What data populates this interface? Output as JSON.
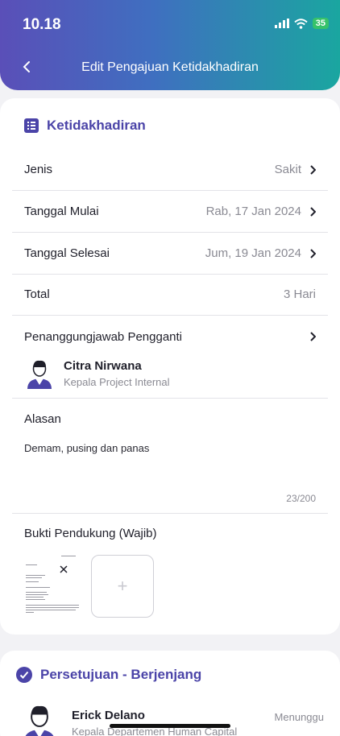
{
  "status_bar": {
    "time": "10.18",
    "battery": "35"
  },
  "header": {
    "title": "Edit Pengajuan Ketidakhadiran"
  },
  "absence_section": {
    "title": "Ketidakhadiran",
    "rows": [
      {
        "label": "Jenis",
        "value": "Sakit"
      },
      {
        "label": "Tanggal Mulai",
        "value": "Rab, 17 Jan 2024"
      },
      {
        "label": "Tanggal Selesai",
        "value": "Jum, 19 Jan 2024"
      },
      {
        "label": "Total",
        "value": "3 Hari"
      }
    ],
    "substitute": {
      "label": "Penanggungjawab Pengganti",
      "name": "Citra Nirwana",
      "role": "Kepala Project Internal"
    },
    "reason": {
      "label": "Alasan",
      "text": "Demam, pusing dan panas",
      "counter": "23/200"
    },
    "evidence": {
      "label": "Bukti Pendukung (Wajib)",
      "add_symbol": "+"
    }
  },
  "approval_section": {
    "title": "Persetujuan - Berjenjang",
    "approver": {
      "name": "Erick Delano",
      "role": "Kepala Departemen Human Capital",
      "status": "Menunggu"
    }
  },
  "colors": {
    "accent": "#4b44a8",
    "gradient_start": "#5a4fb8",
    "gradient_end": "#1aa6a0"
  }
}
